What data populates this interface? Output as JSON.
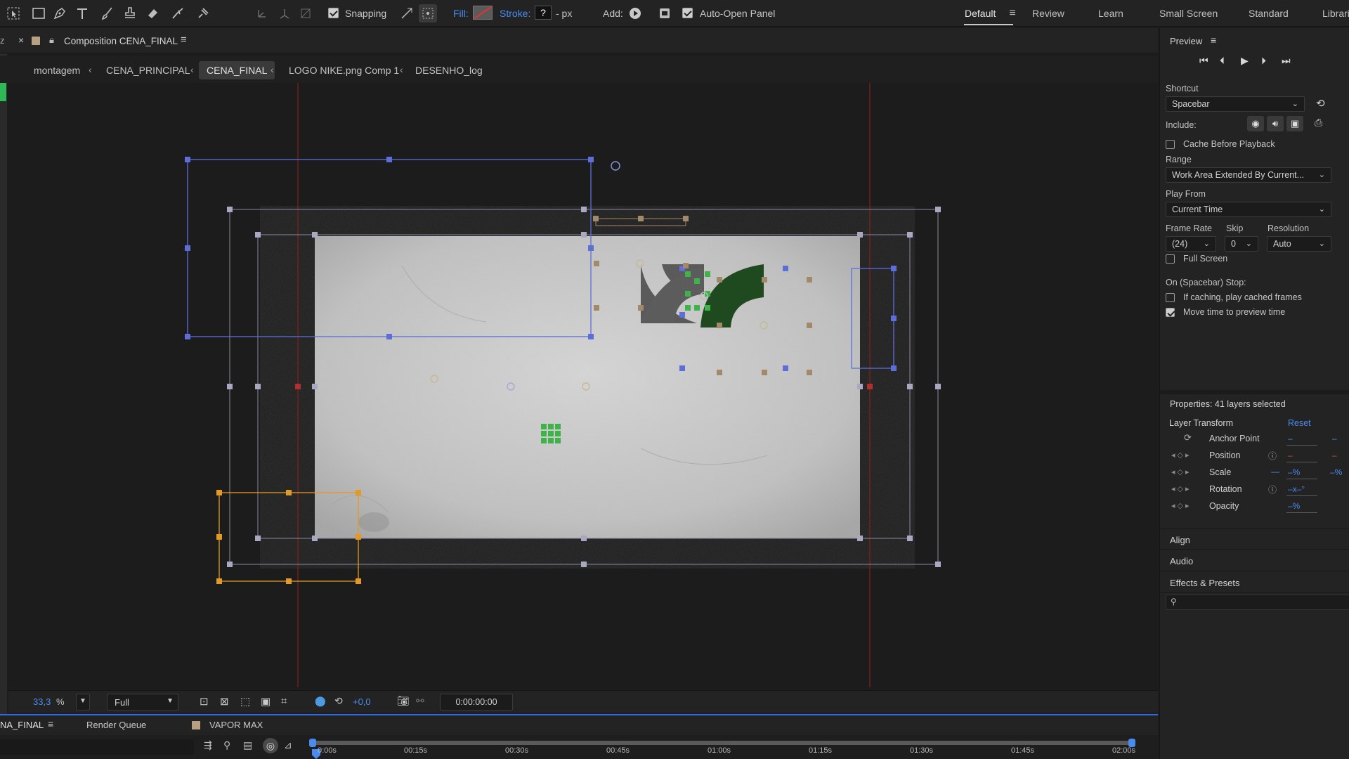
{
  "toolbar": {
    "snapping_label": "Snapping",
    "fill_label": "Fill:",
    "stroke_label": "Stroke:",
    "stroke_value": "?",
    "stroke_unit": "- px",
    "add_label": "Add:",
    "auto_open_label": "Auto-Open Panel",
    "workspaces": [
      "Default",
      "Review",
      "Learn",
      "Small Screen",
      "Standard",
      "Librari"
    ],
    "active_workspace": "Default"
  },
  "comp": {
    "panel_title": "Composition CENA_FINAL",
    "breadcrumbs": [
      "montagem",
      "CENA_PRINCIPAL",
      "CENA_FINAL",
      "LOGO NIKE.png Comp 1",
      "DESENHO_log"
    ],
    "active_crumb": "CENA_FINAL",
    "zoom_value": "33,3",
    "zoom_unit": "%",
    "resolution": "Full",
    "exposure": "+0,0",
    "timecode": "0:00:00:00"
  },
  "timeline": {
    "tabs": [
      "NA_FINAL",
      "Render Queue",
      "VAPOR MAX"
    ],
    "ruler": [
      "0:00s",
      "00:15s",
      "00:30s",
      "00:45s",
      "01:00s",
      "01:15s",
      "01:30s",
      "01:45s",
      "02:00s"
    ]
  },
  "preview": {
    "title": "Preview",
    "shortcut_label": "Shortcut",
    "shortcut_value": "Spacebar",
    "include_label": "Include:",
    "cache_label": "Cache Before Playback",
    "cache_checked": false,
    "range_label": "Range",
    "range_value": "Work Area Extended By Current...",
    "play_from_label": "Play From",
    "play_from_value": "Current Time",
    "frame_rate_label": "Frame Rate",
    "frame_rate_value": "(24)",
    "skip_label": "Skip",
    "skip_value": "0",
    "resolution_label": "Resolution",
    "resolution_value": "Auto",
    "full_screen_label": "Full Screen",
    "full_screen_checked": false,
    "stop_label": "On (Spacebar) Stop:",
    "caching_label": "If caching, play cached frames",
    "caching_checked": false,
    "move_time_label": "Move time to preview time",
    "move_time_checked": true
  },
  "properties": {
    "header": "Properties: 41 layers selected",
    "section": "Layer Transform",
    "reset_label": "Reset",
    "rows": [
      {
        "name": "Anchor Point",
        "v1": "–",
        "v2": "–"
      },
      {
        "name": "Position",
        "v1": "–",
        "v2": "–"
      },
      {
        "name": "Scale",
        "v1": "–%",
        "v2": "–%"
      },
      {
        "name": "Rotation",
        "v1": "–x–°",
        "v2": ""
      },
      {
        "name": "Opacity",
        "v1": "–%",
        "v2": ""
      }
    ]
  },
  "panels": [
    "Align",
    "Audio",
    "Effects & Presets"
  ],
  "colors": {
    "accent_blue": "#4a8bf0",
    "guide_red": "#8a1e1e",
    "handle_blue": "#5d6fd6",
    "handle_orange": "#e09a25",
    "handle_tan": "#a08a6a",
    "handle_green": "#3fb24a",
    "shape_green": "#1f4a1f",
    "shape_gray": "#5a5a5a"
  }
}
